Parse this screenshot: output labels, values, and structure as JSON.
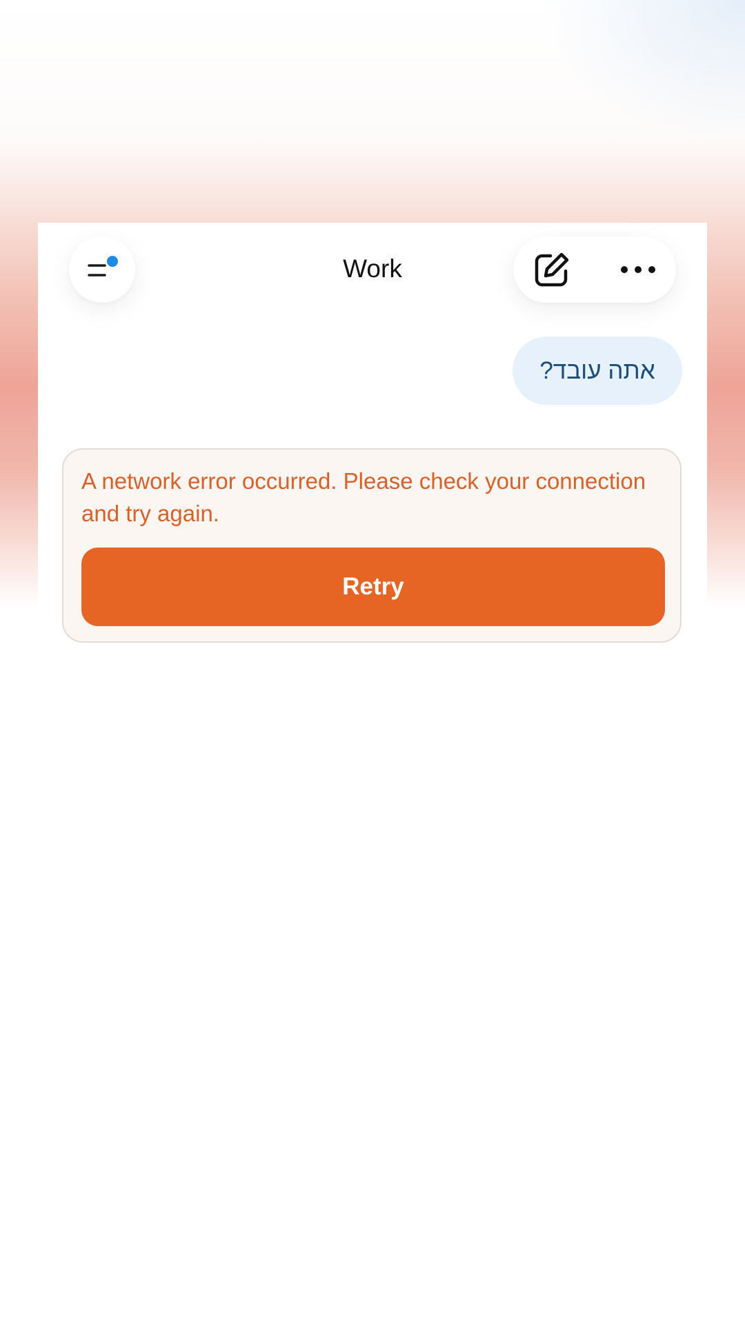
{
  "header": {
    "title": "Work",
    "menu_icon": "menu-icon",
    "notification_dot_color": "#1e88e5",
    "compose_icon": "compose-icon",
    "more_icon": "more-icon"
  },
  "conversation": {
    "user_message": "אתה עובד?"
  },
  "error": {
    "message": "A network error occurred. Please check your connection and try again.",
    "retry_label": "Retry",
    "accent_color": "#e66424"
  }
}
